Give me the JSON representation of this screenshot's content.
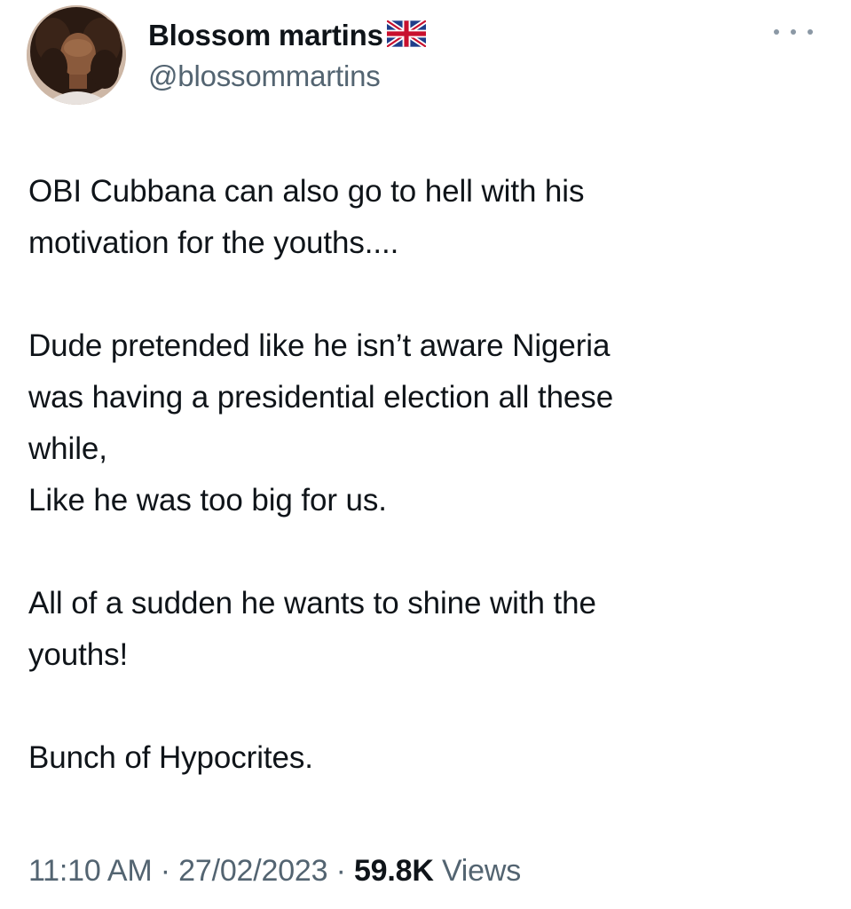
{
  "author": {
    "display_name": "Blossom martins",
    "flag_icon": "uk-flag-icon",
    "handle": "@blossommartins"
  },
  "more_icon": "more-options-icon",
  "tweet": {
    "paragraphs": [
      [
        "OBI Cubbana can also go to hell with his",
        "motivation for the youths...."
      ],
      [
        "Dude pretended like he isn’t aware Nigeria",
        "was having a presidential election all these",
        "while,",
        "Like he was too big for us."
      ],
      [
        "All of a sudden he wants to shine with the",
        "youths!"
      ],
      [
        "Bunch of Hypocrites."
      ]
    ]
  },
  "meta": {
    "time": "11:10 AM",
    "separator": "·",
    "date": "27/02/2023",
    "views_count": "59.8K",
    "views_label": "Views"
  },
  "colors": {
    "text": "#0f1419",
    "secondary": "#536471"
  }
}
